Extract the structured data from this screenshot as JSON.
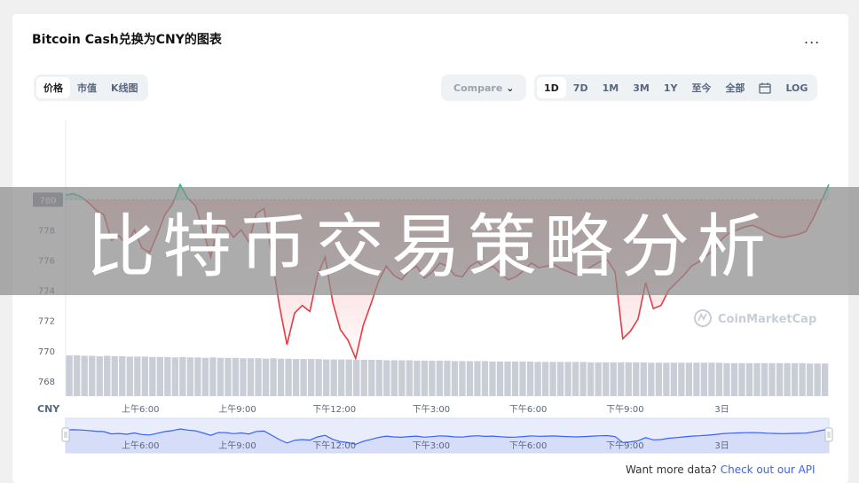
{
  "title": "Bitcoin Cash兑换为CNY的图表",
  "more_label": "...",
  "type_tabs": [
    "价格",
    "市值",
    "K线图"
  ],
  "compare_label": "Compare",
  "range_tabs": [
    "1D",
    "7D",
    "1M",
    "3M",
    "1Y",
    "至今",
    "全部"
  ],
  "log_label": "LOG",
  "icons": {
    "calendar": "calendar-icon",
    "watermark": "coinmarketcap-logo"
  },
  "watermark": "CoinMarketCap",
  "overlay_text": "比特币交易策略分析",
  "api": {
    "prefix": "Want more data?",
    "link": "Check out our API"
  },
  "colors": {
    "up": "#16c784",
    "down": "#ea3943",
    "accent": "#3861fb"
  },
  "chart_data": {
    "type": "line",
    "currency_label": "CNY",
    "reference_value": 780,
    "ylim": [
      767,
      785
    ],
    "y_ticks": [
      768,
      770,
      772,
      774,
      776,
      778
    ],
    "x_range": [
      0,
      100
    ],
    "x_ticks": [
      {
        "x": 9.8,
        "label": "上午6:00"
      },
      {
        "x": 22.5,
        "label": "上午9:00"
      },
      {
        "x": 35.2,
        "label": "下午12:00"
      },
      {
        "x": 47.9,
        "label": "下午3:00"
      },
      {
        "x": 60.6,
        "label": "下午6:00"
      },
      {
        "x": 73.3,
        "label": "下午9:00"
      },
      {
        "x": 86.0,
        "label": "3日"
      }
    ],
    "x": [
      0,
      1,
      2,
      3,
      4,
      5,
      6,
      7,
      8,
      9,
      10,
      11,
      12,
      13,
      14,
      15,
      16,
      17,
      18,
      19,
      20,
      21,
      22,
      23,
      24,
      25,
      26,
      27,
      28,
      29,
      30,
      31,
      32,
      33,
      34,
      35,
      36,
      37,
      38,
      39,
      40,
      41,
      42,
      43,
      44,
      45,
      46,
      47,
      48,
      49,
      50,
      51,
      52,
      53,
      54,
      55,
      56,
      57,
      58,
      59,
      60,
      61,
      62,
      63,
      64,
      65,
      66,
      67,
      68,
      69,
      70,
      71,
      72,
      73,
      74,
      75,
      76,
      77,
      78,
      79,
      80,
      81,
      82,
      83,
      84,
      85,
      86,
      87,
      88,
      89,
      90,
      91,
      92,
      93,
      94,
      95,
      96,
      97,
      98,
      99,
      100
    ],
    "values": [
      780.3,
      780.4,
      780.2,
      779.8,
      779.3,
      779.0,
      777.3,
      777.6,
      777.0,
      778.0,
      776.8,
      776.5,
      777.7,
      779.0,
      779.7,
      781.0,
      780.1,
      779.6,
      778.0,
      776.2,
      778.3,
      778.2,
      777.5,
      778.0,
      777.2,
      779.1,
      779.4,
      776.3,
      773.0,
      770.4,
      772.5,
      773.0,
      772.6,
      775.0,
      776.2,
      773.2,
      771.4,
      770.7,
      769.5,
      771.7,
      773.1,
      774.6,
      775.6,
      775.0,
      774.7,
      775.3,
      775.6,
      774.8,
      775.2,
      775.8,
      775.6,
      775.0,
      774.9,
      775.6,
      775.9,
      775.4,
      775.6,
      775.1,
      774.7,
      774.9,
      775.3,
      775.8,
      775.5,
      775.6,
      775.7,
      775.4,
      775.2,
      775.0,
      775.3,
      775.6,
      775.9,
      776.0,
      775.2,
      770.8,
      771.3,
      772.1,
      774.5,
      772.8,
      773.0,
      774.0,
      774.5,
      775.0,
      775.6,
      775.9,
      776.3,
      776.7,
      777.4,
      777.8,
      778.0,
      778.2,
      778.3,
      778.1,
      777.8,
      777.6,
      777.5,
      777.6,
      777.7,
      777.9,
      778.8,
      779.9,
      781.0
    ],
    "volume": [
      1.0,
      1.0,
      0.99,
      0.99,
      0.98,
      0.99,
      0.98,
      0.98,
      0.97,
      0.97,
      0.97,
      0.96,
      0.96,
      0.96,
      0.95,
      0.96,
      0.95,
      0.95,
      0.94,
      0.95,
      0.94,
      0.94,
      0.94,
      0.93,
      0.93,
      0.93,
      0.92,
      0.93,
      0.92,
      0.92,
      0.91,
      0.91,
      0.91,
      0.91,
      0.9,
      0.9,
      0.9,
      0.9,
      0.89,
      0.89,
      0.89,
      0.89,
      0.88,
      0.88,
      0.88,
      0.88,
      0.87,
      0.87,
      0.87,
      0.87,
      0.87,
      0.86,
      0.86,
      0.86,
      0.86,
      0.86,
      0.85,
      0.85,
      0.85,
      0.85,
      0.85,
      0.85,
      0.84,
      0.84,
      0.84,
      0.84,
      0.84,
      0.84,
      0.84,
      0.83,
      0.83,
      0.83,
      0.83,
      0.83,
      0.83,
      0.83,
      0.83,
      0.82,
      0.82,
      0.82,
      0.82,
      0.82,
      0.82,
      0.82,
      0.82,
      0.82,
      0.82,
      0.81,
      0.81,
      0.81,
      0.81,
      0.81,
      0.81,
      0.81,
      0.81,
      0.81,
      0.81,
      0.81,
      0.8,
      0.8,
      0.8
    ],
    "grid": false,
    "legend": "none"
  }
}
